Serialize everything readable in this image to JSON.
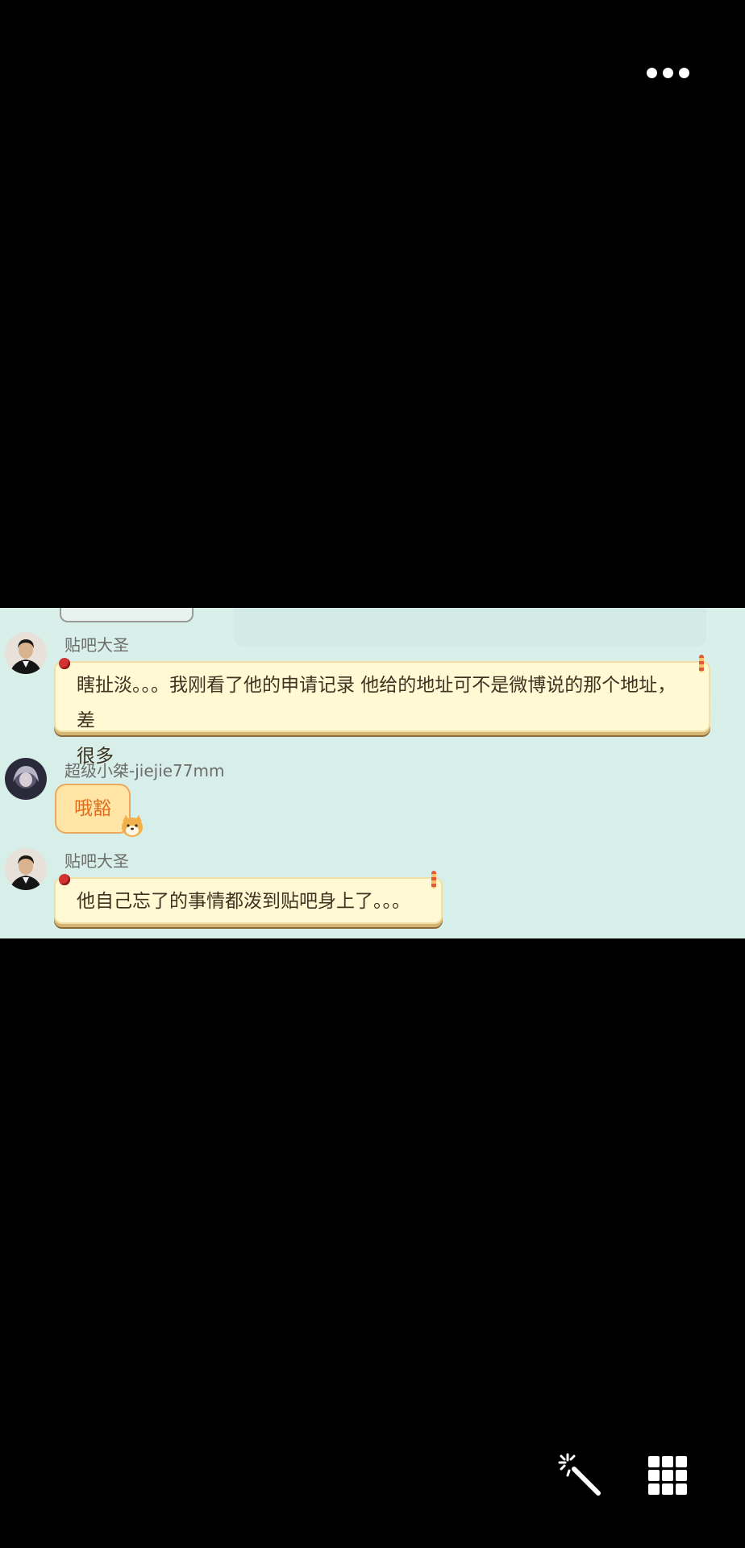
{
  "messages": [
    {
      "user": "贴吧大圣",
      "line1": "瞎扯淡。。。我刚看了他的申请记录 他给的地址可不是微博说的那个地址，差",
      "line2": "很多"
    },
    {
      "user": "超级小桀-jiejie77mm",
      "text": "哦豁"
    },
    {
      "user": "贴吧大圣",
      "text": "他自己忘了的事情都泼到贴吧身上了。。。"
    }
  ],
  "icons": {
    "top_right": "more-dots-icon",
    "bottom_left_action": "magic-wand-icon",
    "bottom_right_action": "grid-icon",
    "sticker": "shiba-dog-icon"
  },
  "colors": {
    "background": "#000000",
    "chat_bg": "#d8efe9",
    "bubble": "#fff9d4",
    "small_bubble": "#ffe6a6",
    "small_bubble_text": "#e26b1a"
  }
}
